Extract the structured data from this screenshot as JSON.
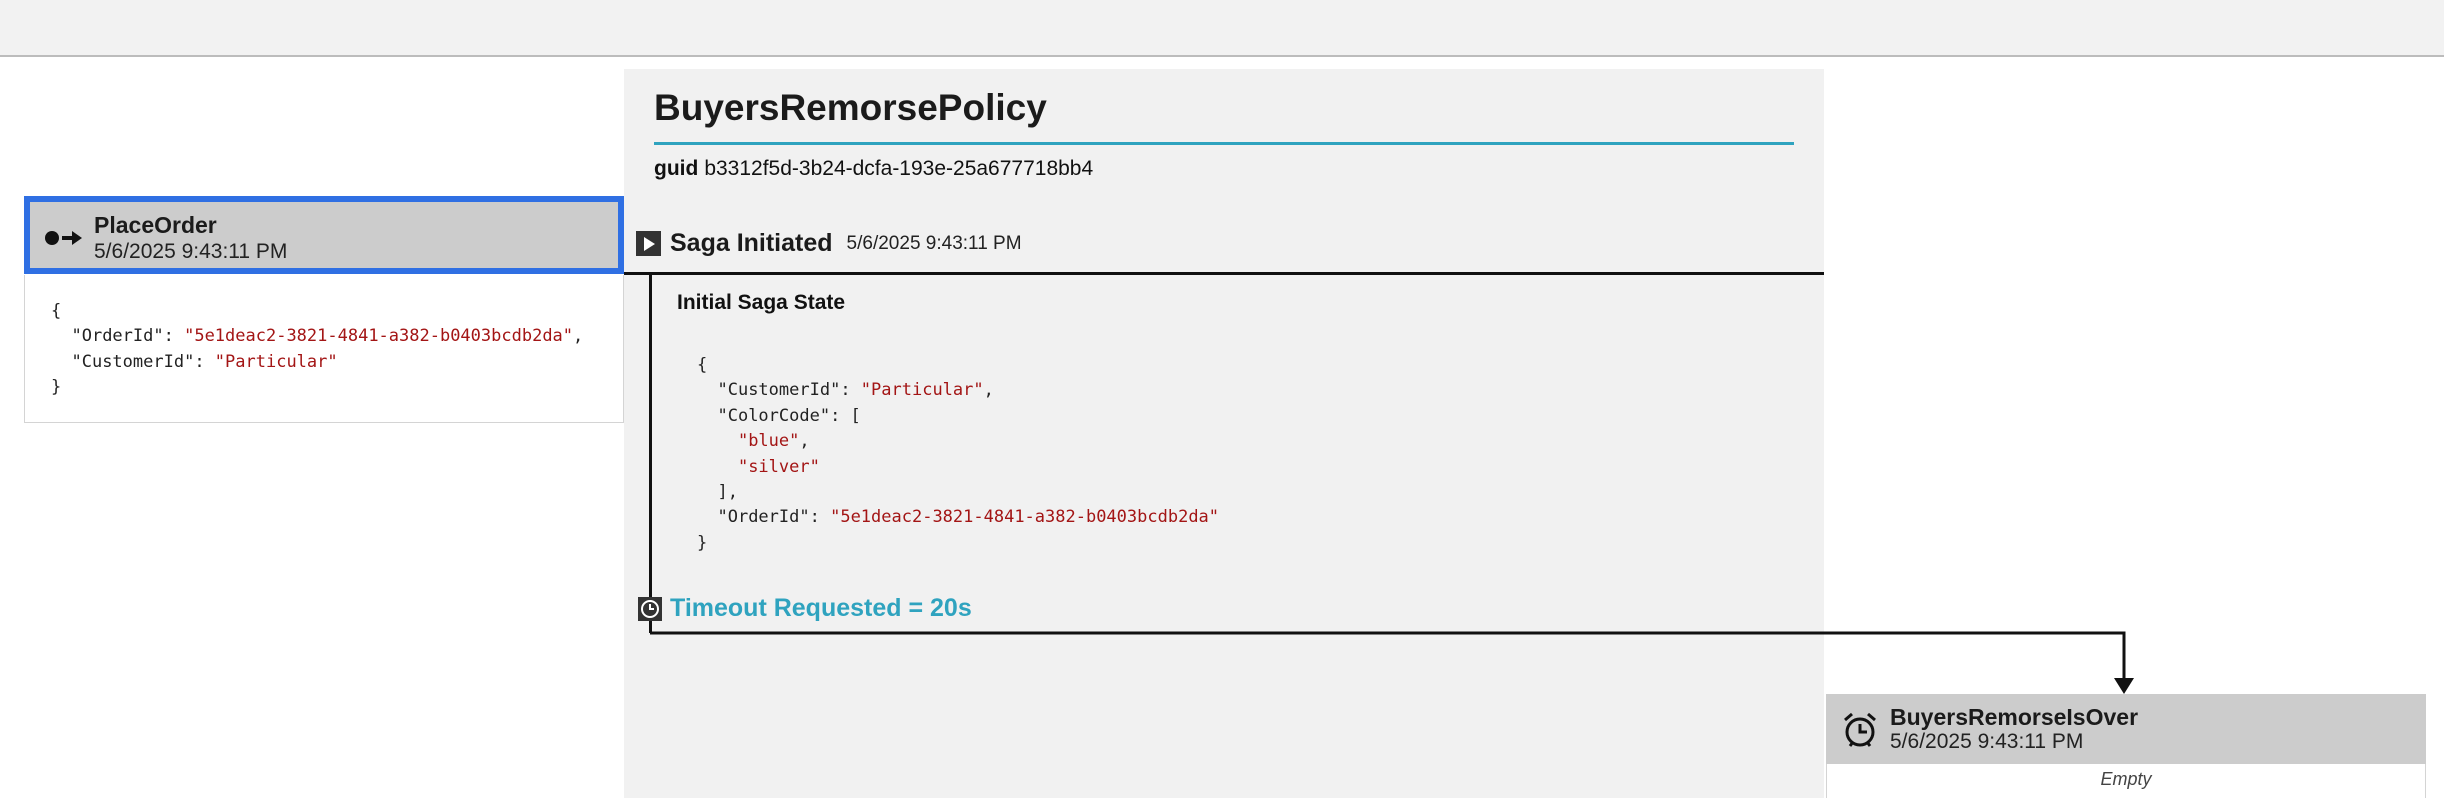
{
  "saga": {
    "title": "BuyersRemorsePolicy",
    "guid_label": "guid",
    "guid_value": "b3312f5d-3b24-dcfa-193e-25a677718bb4",
    "initiated_label": "Saga Initiated",
    "initiated_time": "5/6/2025 9:43:11 PM",
    "state_heading": "Initial Saga State",
    "state_json": {
      "customer_key": "\"CustomerId\"",
      "customer_val": "\"Particular\"",
      "color_key": "\"ColorCode\"",
      "color_val_1": "\"blue\"",
      "color_val_2": "\"silver\"",
      "order_key": "\"OrderId\"",
      "order_val": "\"5e1deac2-3821-4841-a382-b0403bcdb2da\""
    },
    "timeout_label": "Timeout Requested = 20s"
  },
  "incoming_message": {
    "name": "PlaceOrder",
    "time": "5/6/2025 9:43:11 PM",
    "icon": "command-arrow-icon",
    "json": {
      "order_key": "\"OrderId\"",
      "order_val": "\"5e1deac2-3821-4841-a382-b0403bcdb2da\"",
      "customer_key": "\"CustomerId\"",
      "customer_val": "\"Particular\""
    }
  },
  "timeout_message": {
    "name": "BuyersRemorseIsOver",
    "time": "5/6/2025 9:43:11 PM",
    "icon": "alarm-clock-icon",
    "body": "Empty"
  },
  "colors": {
    "accent": "#2fa3bf",
    "selected_border": "#2f6fe3",
    "json_string": "#a31515"
  }
}
